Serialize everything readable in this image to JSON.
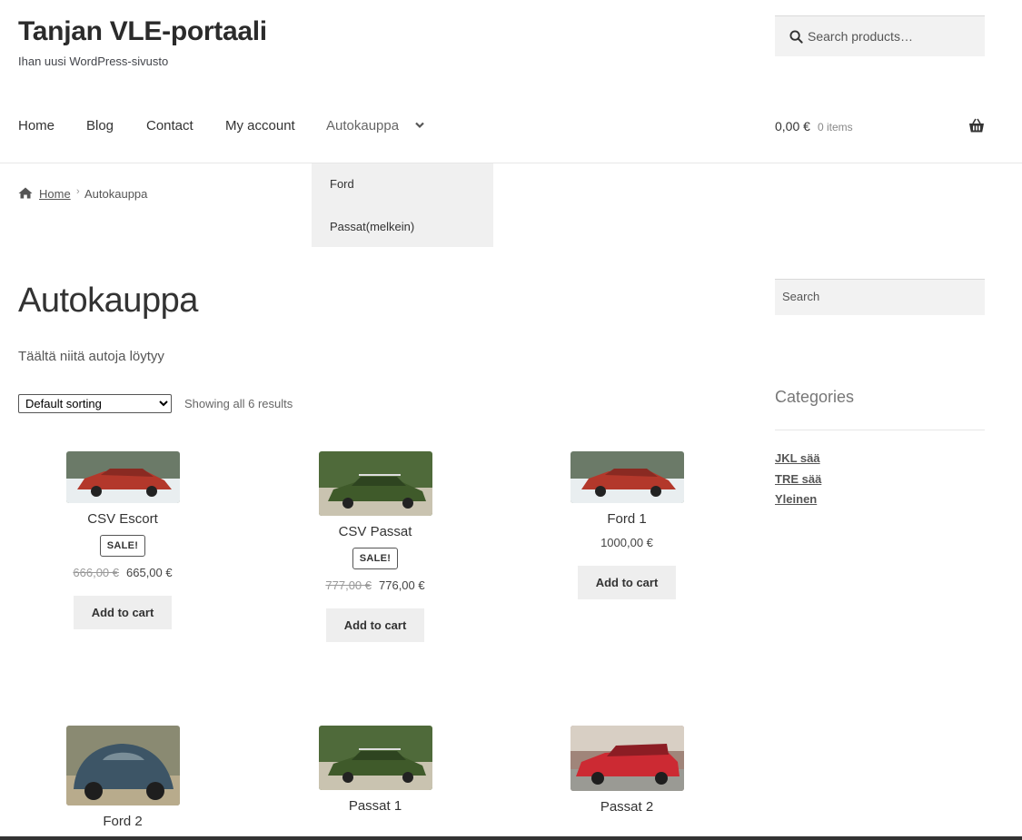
{
  "site": {
    "title": "Tanjan VLE-portaali",
    "description": "Ihan uusi WordPress-sivusto"
  },
  "search": {
    "placeholder": "Search products…"
  },
  "nav": {
    "items": [
      "Home",
      "Blog",
      "Contact",
      "My account",
      "Autokauppa"
    ],
    "dropdown": [
      "Ford",
      "Passat(melkein)"
    ]
  },
  "cart": {
    "total": "0,00 €",
    "count": "0 items"
  },
  "breadcrumb": {
    "home": "Home",
    "current": "Autokauppa"
  },
  "page": {
    "title": "Autokauppa",
    "description": "Täältä niitä autoja löytyy",
    "sorting": "Default sorting",
    "result_count": "Showing all 6 results"
  },
  "sidebar": {
    "search_placeholder": "Search",
    "categories_title": "Categories",
    "categories": [
      "JKL sää",
      "TRE sää",
      "Yleinen"
    ]
  },
  "products": [
    {
      "name": "CSV Escort",
      "badge": "SALE!",
      "old_price": "666,00 €",
      "price": "665,00 €",
      "button": "Add to cart"
    },
    {
      "name": "CSV Passat",
      "badge": "SALE!",
      "old_price": "777,00 €",
      "price": "776,00 €",
      "button": "Add to cart"
    },
    {
      "name": "Ford 1",
      "price": "1000,00 €",
      "button": "Add to cart"
    },
    {
      "name": "Ford 2"
    },
    {
      "name": "Passat 1"
    },
    {
      "name": "Passat 2"
    }
  ]
}
